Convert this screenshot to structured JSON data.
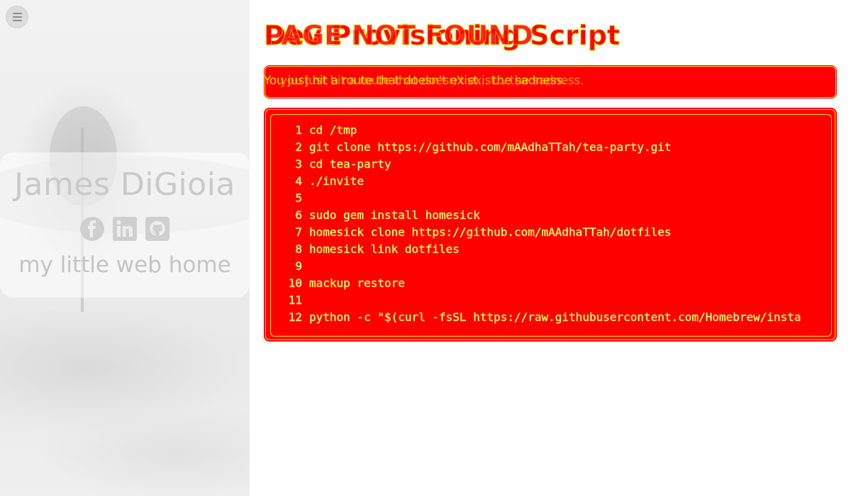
{
  "sidebar": {
    "menu_icon": "hamburger-menu-icon",
    "name": "James DiGioia",
    "tagline": "my little web home",
    "social": [
      {
        "name": "facebook",
        "icon": "facebook-icon"
      },
      {
        "name": "linkedin",
        "icon": "linkedin-icon"
      },
      {
        "name": "github",
        "icon": "github-icon"
      }
    ]
  },
  "main": {
    "title_layers": [
      "PAGE NOT FOUND",
      "Dev Provisioning Script"
    ],
    "alert": {
      "layers": [
        "You just hit a route that doesn't exist... the sadness.",
        "Yo you just hit a route that doesn't exist... the sadness."
      ]
    },
    "code": {
      "lines": [
        {
          "num": "1",
          "text": "cd /tmp"
        },
        {
          "num": "2",
          "text": "git clone https://github.com/mAAdhaTTah/tea-party.git"
        },
        {
          "num": "3",
          "text": "cd tea-party"
        },
        {
          "num": "4",
          "text": "./invite"
        },
        {
          "num": "5",
          "text": ""
        },
        {
          "num": "6",
          "text": "sudo gem install homesick"
        },
        {
          "num": "7",
          "text": "homesick clone https://github.com/mAAdhaTTah/dotfiles"
        },
        {
          "num": "8",
          "text": "homesick link dotfiles"
        },
        {
          "num": "9",
          "text": ""
        },
        {
          "num": "10",
          "text": "mackup restore"
        },
        {
          "num": "11",
          "text": ""
        },
        {
          "num": "12",
          "text": "python -c \"$(curl -fsSL https://raw.githubusercontent.com/Homebrew/insta"
        }
      ]
    }
  },
  "colors": {
    "accent_red": "#ff0000",
    "outline_yellow": "#ffe000",
    "sidebar_text": "#c9c9c9"
  }
}
